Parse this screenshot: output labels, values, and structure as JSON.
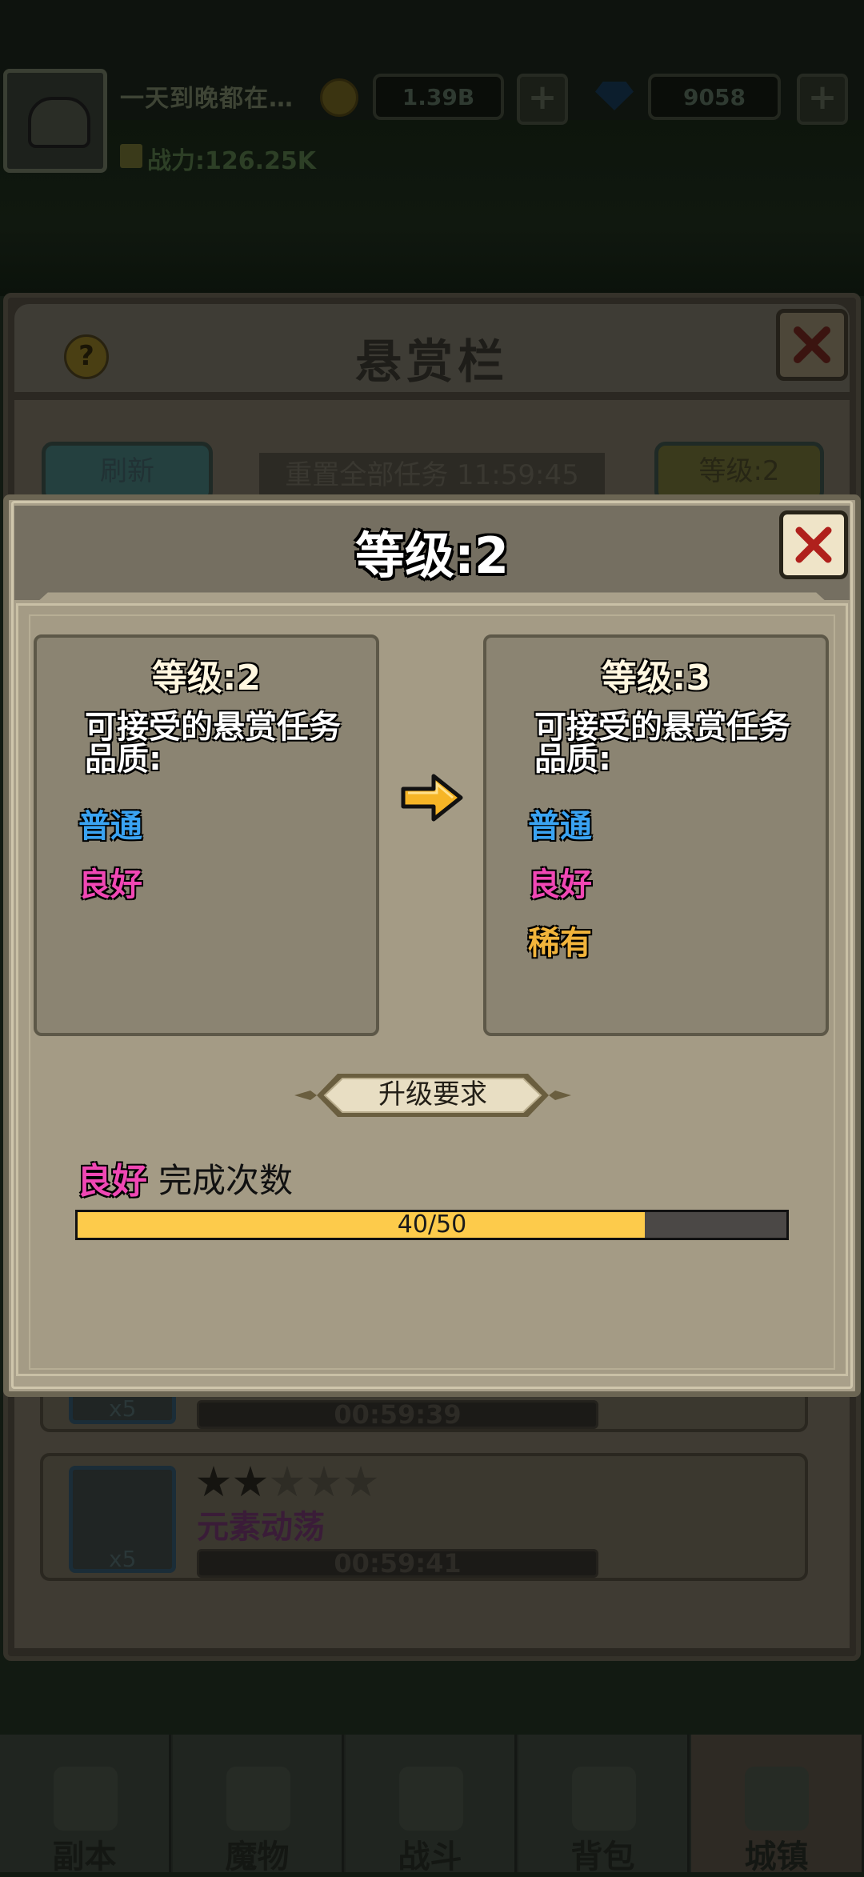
{
  "top_bar": {
    "player_name": "一天到晚都在…",
    "gold": "1.39B",
    "gems": "9058",
    "power": "战力:126.25K"
  },
  "bounty_board": {
    "title": "悬赏栏",
    "refresh_label": "刷新",
    "reset_timer": "重置全部任务 11:59:45",
    "level_label": "等级:2",
    "tasks": [
      {
        "count": "x5",
        "timer": "00:59:39"
      },
      {
        "count": "x5",
        "timer": "00:59:41",
        "name": "元素动荡",
        "stars": 2
      }
    ]
  },
  "dialog": {
    "title": "等级:2",
    "current": {
      "heading": "等级:2",
      "desc": "可接受的悬赏任务品质:",
      "qualities": [
        "普通",
        "良好"
      ]
    },
    "next": {
      "heading": "等级:3",
      "desc": "可接受的悬赏任务品质:",
      "qualities": [
        "普通",
        "良好",
        "稀有"
      ]
    },
    "requirement_title": "升级要求",
    "requirement_quality": "良好",
    "requirement_label": "完成次数",
    "progress_text": "40/50",
    "progress_fraction": 0.8
  },
  "bottom_nav": [
    "副本",
    "魔物",
    "战斗",
    "背包",
    "城镇"
  ],
  "colors": {
    "normal": "#3aa3f2",
    "good": "#f047b4",
    "rare": "#f2b43b",
    "progress_fill": "#fdcb4b"
  }
}
